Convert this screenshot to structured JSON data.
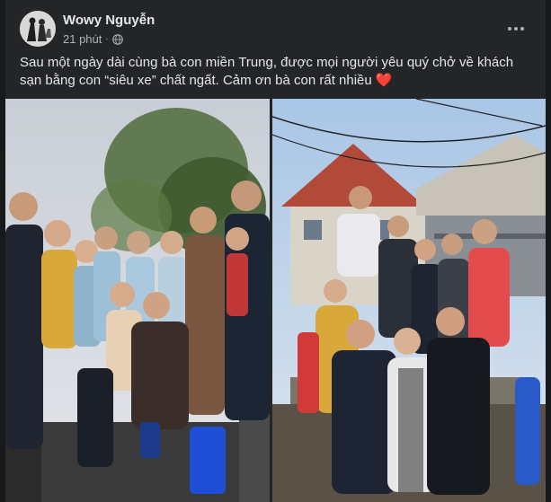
{
  "post": {
    "author": "Wowy Nguyễn",
    "time": "21 phút",
    "separator": "·",
    "privacy_icon": "globe-icon",
    "more_icon": "more-options-icon",
    "caption": "Sau một ngày dài cùng bà con miền Trung, được mọi người yêu quý chở về khách sạn bằng con “siêu xe” chất ngất. Cảm ơn bà con rất nhiều",
    "caption_emoji": "❤️"
  },
  "photos": [
    {
      "name": "group-photo-on-truck-1"
    },
    {
      "name": "group-photo-on-truck-2"
    }
  ],
  "colors": {
    "background": "#18191a",
    "card": "#242526",
    "primary_text": "#e4e6eb",
    "secondary_text": "#b0b3b8"
  }
}
